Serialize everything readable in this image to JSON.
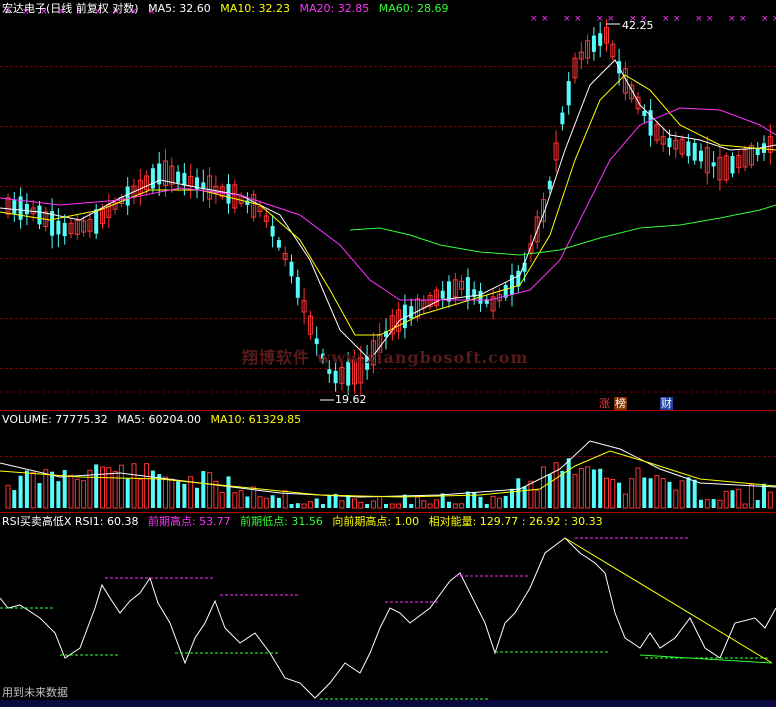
{
  "main_panel": {
    "title": "宏达电子(日线 前复权 对数)",
    "indicators": [
      {
        "label": "MA5: 32.60",
        "color": "#ffffff"
      },
      {
        "label": "MA10: 32.23",
        "color": "#ffff00"
      },
      {
        "label": "MA20: 32.85",
        "color": "#ff33ff"
      },
      {
        "label": "MA60: 28.69",
        "color": "#33ff33"
      }
    ],
    "high_label": "42.25",
    "low_label": "19.62",
    "markers": {
      "zhang_label": "涨",
      "bang_label": "榜",
      "cai_label": "财"
    },
    "watermark": "翔博软件 www.xiangbosoft.com",
    "colors": {
      "up": "#ff3232",
      "down": "#54fcfc",
      "ma5": "#ffffff",
      "ma10": "#ffff00",
      "ma20": "#ff33ff",
      "ma60": "#33ff33"
    }
  },
  "volume_panel": {
    "indicators": [
      {
        "label": "VOLUME: 77775.32",
        "color": "#ffffff"
      },
      {
        "label": "MA5: 60204.00",
        "color": "#ffffff"
      },
      {
        "label": "MA10: 61329.85",
        "color": "#ffff00"
      }
    ]
  },
  "rsi_panel": {
    "indicators": [
      {
        "label": "RSI买卖高低X  RSI1: 60.38",
        "color": "#ffffff"
      },
      {
        "label": "前期高点: 53.77",
        "color": "#ff33ff"
      },
      {
        "label": "前期低点: 31.56",
        "color": "#33ff33"
      },
      {
        "label": "向前期高点: 1.00",
        "color": "#ffff00"
      },
      {
        "label": "相对能量: 129.77 : 26.92 : 30.33",
        "color": "#ffff00"
      }
    ]
  },
  "footer": {
    "note": "用到未来数据"
  },
  "chart_data": {
    "type": "candlestick",
    "title": "宏达电子(日线 前复权 对数)",
    "price_high": 42.25,
    "price_low": 19.62,
    "series": [
      {
        "name": "MA5",
        "last": 32.6
      },
      {
        "name": "MA10",
        "last": 32.23
      },
      {
        "name": "MA20",
        "last": 32.85
      },
      {
        "name": "MA60",
        "last": 28.69
      }
    ],
    "volume": {
      "last": 77775.32,
      "ma5": 60204.0,
      "ma10": 61329.85
    },
    "rsi": {
      "rsi1": 60.38,
      "prev_high": 53.77,
      "prev_low": 31.56,
      "to_prev_high": 1.0,
      "relative_energy": [
        129.77,
        26.92,
        30.33
      ]
    }
  }
}
